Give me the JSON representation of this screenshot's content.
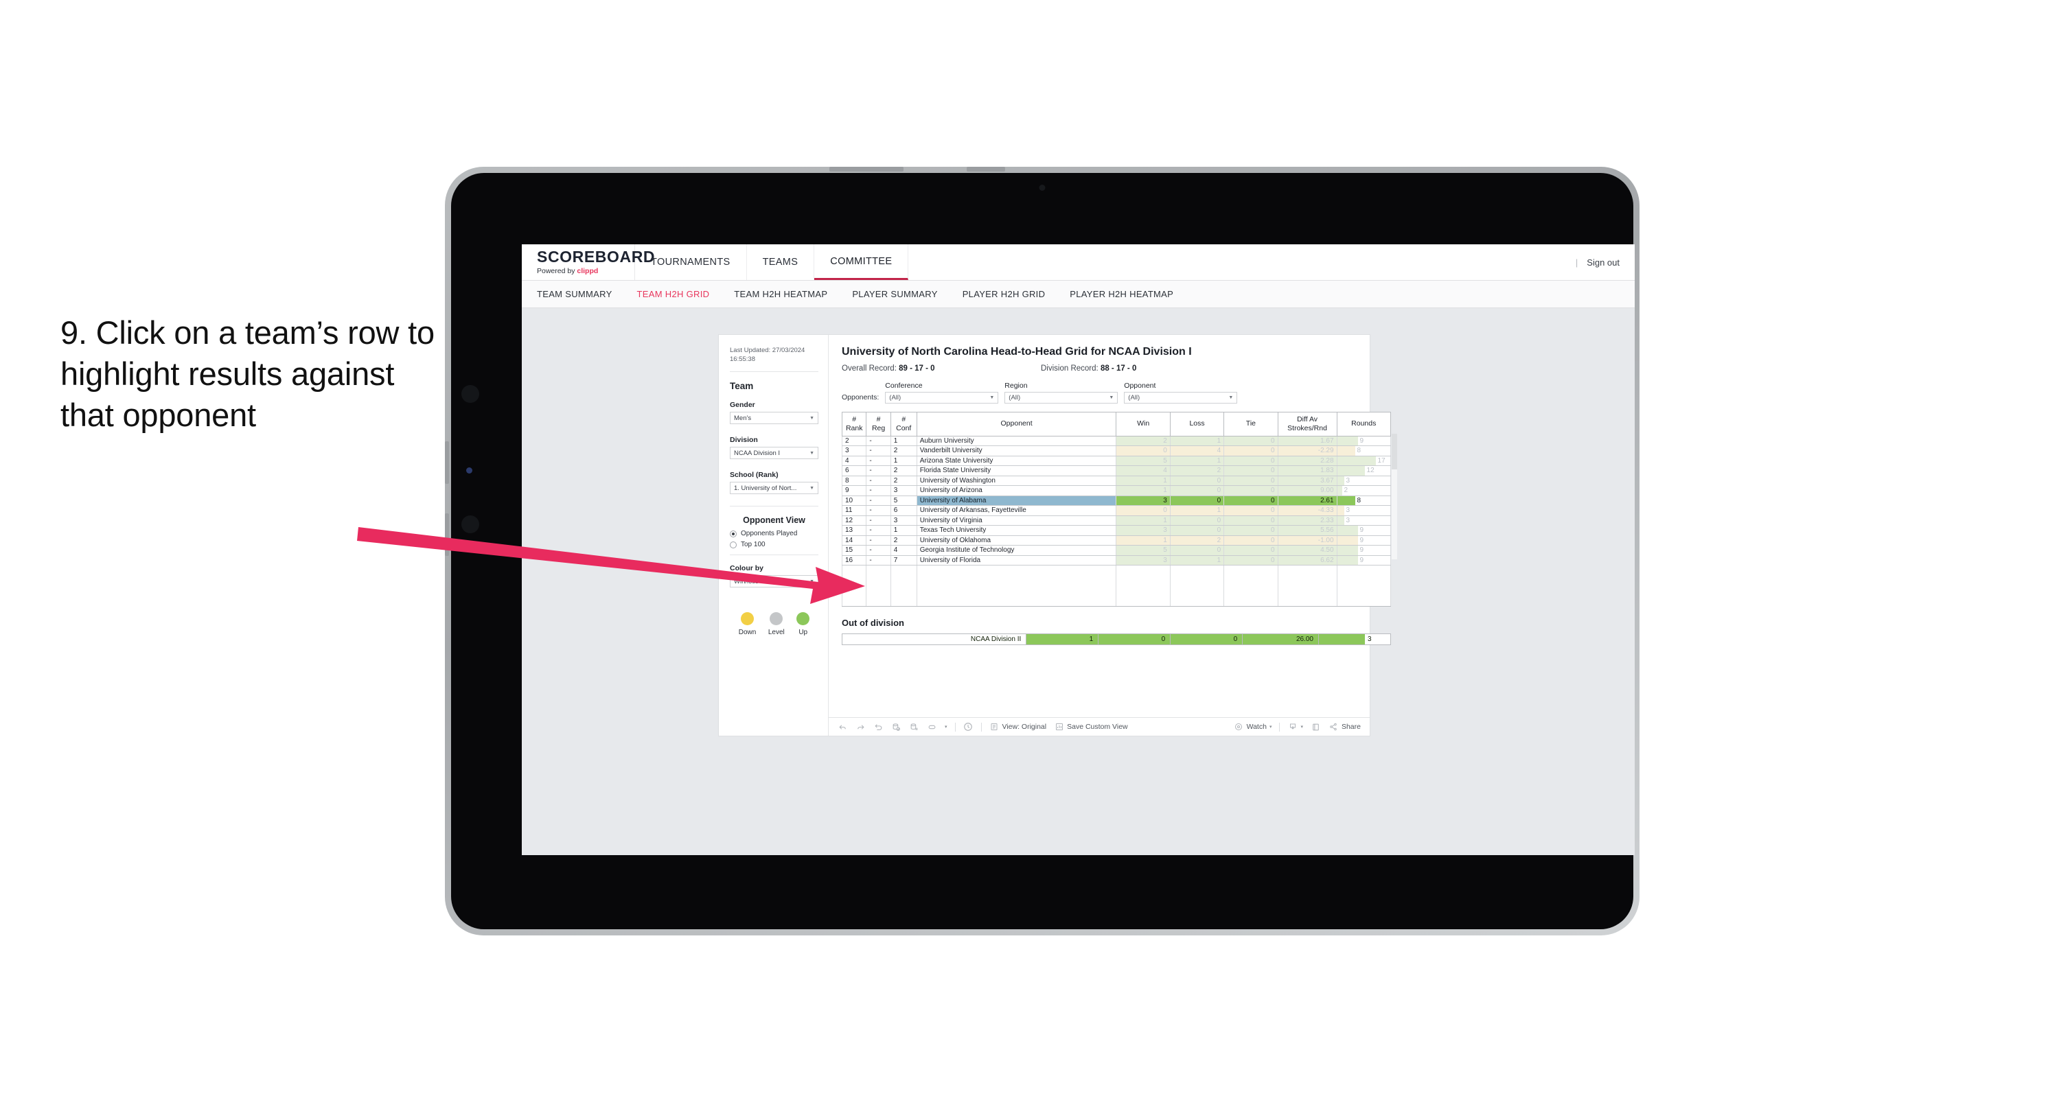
{
  "annotation": {
    "text": "9. Click on a team’s row to highlight results against that opponent",
    "arrow_color": "#e82b5e"
  },
  "topbar": {
    "brand_title": "SCOREBOARD",
    "brand_sub_prefix": "Powered by ",
    "brand_sub_accent": "clippd",
    "nav": [
      {
        "label": "TOURNAMENTS",
        "active": false
      },
      {
        "label": "TEAMS",
        "active": false
      },
      {
        "label": "COMMITTEE",
        "active": true
      }
    ],
    "separator": "|",
    "signout": "Sign out"
  },
  "subnav": {
    "items": [
      {
        "label": "TEAM SUMMARY",
        "active": false
      },
      {
        "label": "TEAM H2H GRID",
        "active": true
      },
      {
        "label": "TEAM H2H HEATMAP",
        "active": false
      },
      {
        "label": "PLAYER SUMMARY",
        "active": false
      },
      {
        "label": "PLAYER H2H GRID",
        "active": false
      },
      {
        "label": "PLAYER H2H HEATMAP",
        "active": false
      }
    ]
  },
  "sidebar": {
    "last_updated": "Last Updated: 27/03/2024 16:55:38",
    "team_heading": "Team",
    "gender_label": "Gender",
    "gender_value": "Men’s",
    "division_label": "Division",
    "division_value": "NCAA Division I",
    "school_label": "School (Rank)",
    "school_value": "1. University of Nort...",
    "opponent_view_heading": "Opponent View",
    "opponent_view_options": [
      {
        "label": "Opponents Played",
        "selected": true
      },
      {
        "label": "Top 100",
        "selected": false
      }
    ],
    "colour_by_label": "Colour by",
    "colour_by_value": "Win/loss",
    "legend": [
      {
        "label": "Down",
        "color": "#f2cf45"
      },
      {
        "label": "Level",
        "color": "#c4c6c8"
      },
      {
        "label": "Up",
        "color": "#8cc75a"
      }
    ]
  },
  "main": {
    "title": "University of North Carolina Head-to-Head Grid for NCAA Division I",
    "overall_record_label": "Overall Record:",
    "overall_record_value": "89 - 17 - 0",
    "division_record_label": "Division Record:",
    "division_record_value": "88 - 17 - 0",
    "opponents_label": "Opponents:",
    "filters": [
      {
        "title": "Conference",
        "value": "(All)"
      },
      {
        "title": "Region",
        "value": "(All)"
      },
      {
        "title": "Opponent",
        "value": "(All)"
      }
    ]
  },
  "table": {
    "headers": {
      "rank": "#\nRank",
      "rank_l1": "#",
      "rank_l2": "Rank",
      "reg_l1": "#",
      "reg_l2": "Reg",
      "conf_l1": "#",
      "conf_l2": "Conf",
      "opponent": "Opponent",
      "win": "Win",
      "loss": "Loss",
      "tie": "Tie",
      "diff_l1": "Diff Av",
      "diff_l2": "Strokes/Rnd",
      "rounds": "Rounds"
    },
    "max_rounds": 17,
    "rows": [
      {
        "rank": "2",
        "reg": "-",
        "conf": "1",
        "opponent": "Auburn University",
        "win": "2",
        "loss": "1",
        "tie": "0",
        "diff": "1.67",
        "rounds": "9",
        "tint": "green",
        "selected": false
      },
      {
        "rank": "3",
        "reg": "-",
        "conf": "2",
        "opponent": "Vanderbilt University",
        "win": "0",
        "loss": "4",
        "tie": "0",
        "diff": "-2.29",
        "rounds": "8",
        "tint": "amber",
        "selected": false
      },
      {
        "rank": "4",
        "reg": "-",
        "conf": "1",
        "opponent": "Arizona State University",
        "win": "5",
        "loss": "1",
        "tie": "0",
        "diff": "2.28",
        "rounds": "17",
        "tint": "green",
        "selected": false
      },
      {
        "rank": "6",
        "reg": "-",
        "conf": "2",
        "opponent": "Florida State University",
        "win": "4",
        "loss": "2",
        "tie": "0",
        "diff": "1.83",
        "rounds": "12",
        "tint": "green",
        "selected": false
      },
      {
        "rank": "8",
        "reg": "-",
        "conf": "2",
        "opponent": "University of Washington",
        "win": "1",
        "loss": "0",
        "tie": "0",
        "diff": "3.67",
        "rounds": "3",
        "tint": "green",
        "selected": false
      },
      {
        "rank": "9",
        "reg": "-",
        "conf": "3",
        "opponent": "University of Arizona",
        "win": "1",
        "loss": "0",
        "tie": "0",
        "diff": "9.00",
        "rounds": "2",
        "tint": "green",
        "selected": false
      },
      {
        "rank": "10",
        "reg": "-",
        "conf": "5",
        "opponent": "University of Alabama",
        "win": "3",
        "loss": "0",
        "tie": "0",
        "diff": "2.61",
        "rounds": "8",
        "tint": "green",
        "selected": true
      },
      {
        "rank": "11",
        "reg": "-",
        "conf": "6",
        "opponent": "University of Arkansas, Fayetteville",
        "win": "0",
        "loss": "1",
        "tie": "0",
        "diff": "-4.33",
        "rounds": "3",
        "tint": "amber",
        "selected": false
      },
      {
        "rank": "12",
        "reg": "-",
        "conf": "3",
        "opponent": "University of Virginia",
        "win": "1",
        "loss": "0",
        "tie": "0",
        "diff": "2.33",
        "rounds": "3",
        "tint": "green",
        "selected": false
      },
      {
        "rank": "13",
        "reg": "-",
        "conf": "1",
        "opponent": "Texas Tech University",
        "win": "3",
        "loss": "0",
        "tie": "0",
        "diff": "5.56",
        "rounds": "9",
        "tint": "green",
        "selected": false
      },
      {
        "rank": "14",
        "reg": "-",
        "conf": "2",
        "opponent": "University of Oklahoma",
        "win": "1",
        "loss": "2",
        "tie": "0",
        "diff": "-1.00",
        "rounds": "9",
        "tint": "amber",
        "selected": false
      },
      {
        "rank": "15",
        "reg": "-",
        "conf": "4",
        "opponent": "Georgia Institute of Technology",
        "win": "5",
        "loss": "0",
        "tie": "0",
        "diff": "4.50",
        "rounds": "9",
        "tint": "green",
        "selected": false
      },
      {
        "rank": "16",
        "reg": "-",
        "conf": "7",
        "opponent": "University of Florida",
        "win": "3",
        "loss": "1",
        "tie": "0",
        "diff": "6.62",
        "rounds": "9",
        "tint": "green",
        "selected": false
      }
    ]
  },
  "out_of_division": {
    "title": "Out of division",
    "row": {
      "label": "NCAA Division II",
      "win": "1",
      "loss": "0",
      "tie": "0",
      "diff": "26.00",
      "rounds": "3"
    }
  },
  "toolbar": {
    "view_label": "View: Original",
    "save_label": "Save Custom View",
    "watch_label": "Watch",
    "share_label": "Share",
    "caret": "▾"
  }
}
